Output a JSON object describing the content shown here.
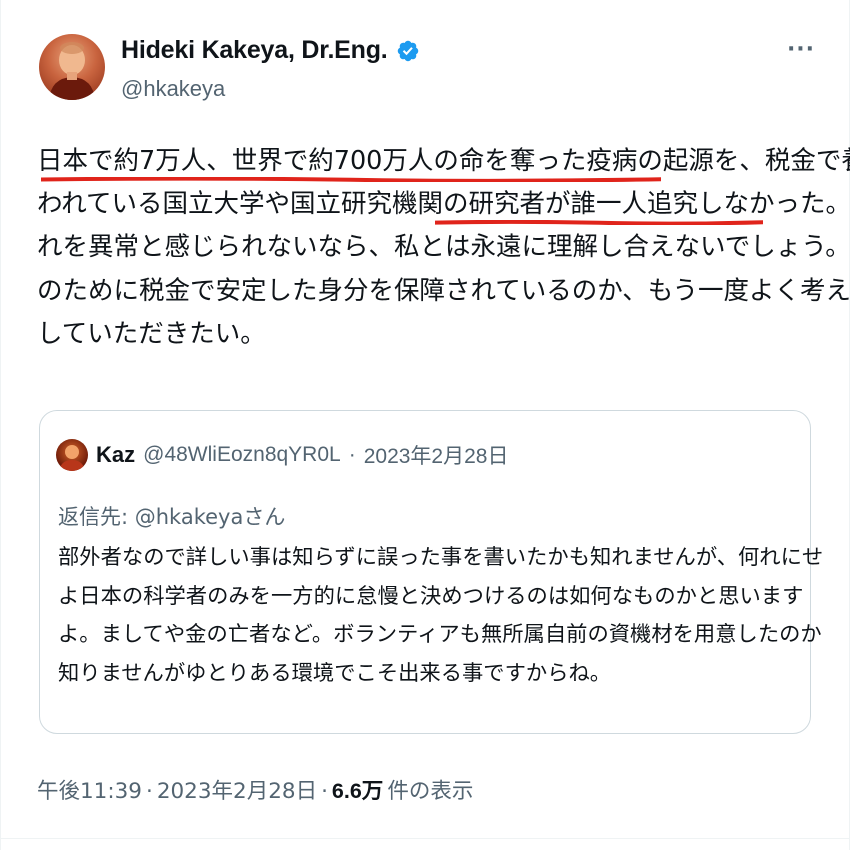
{
  "author": {
    "display_name": "Hideki Kakeya, Dr.Eng.",
    "handle": "@hkakeya",
    "verified": true
  },
  "tweet": {
    "lines": [
      "日本で約7万人、世界で約700万人の命を奪った疫病の起源を、税金で養",
      "われている国立大学や国立研究機関の研究者が誰一人追究しなかった。そ",
      "れを異常と感じられないなら、私とは永遠に理解し合えないでしょう。何",
      "のために税金で安定した身分を保障されているのか、もう一度よく考え直",
      "していただきたい。"
    ],
    "highlight_color": "#e0241b"
  },
  "quoted": {
    "name": "Kaz",
    "handle": "@48WliEozn8qYR0L",
    "date": "2023年2月28日",
    "separator": "·",
    "reply_to": "返信先: @hkakeyaさん",
    "lines": [
      "部外者なので詳しい事は知らずに誤った事を書いたかも知れませんが、何れにせ",
      "よ日本の科学者のみを一方的に怠慢と決めつけるのは如何なものかと思います",
      "よ。ましてや金の亡者など。ボランティアも無所属自前の資機材を用意したのか",
      "知りませんがゆとりある環境でこそ出来る事ですからね。"
    ]
  },
  "footer": {
    "time": "午後11:39",
    "separator1": "·",
    "date": "2023年2月28日",
    "separator2": "·",
    "views_count": "6.6万",
    "views_label": "件の表示"
  },
  "colors": {
    "text": "#0f1419",
    "secondary": "#536471",
    "verified_blue": "#1d9bf0",
    "border": "#cfd9de"
  },
  "icons": {
    "verified": "verified-badge-icon",
    "more": "more-options-icon"
  }
}
